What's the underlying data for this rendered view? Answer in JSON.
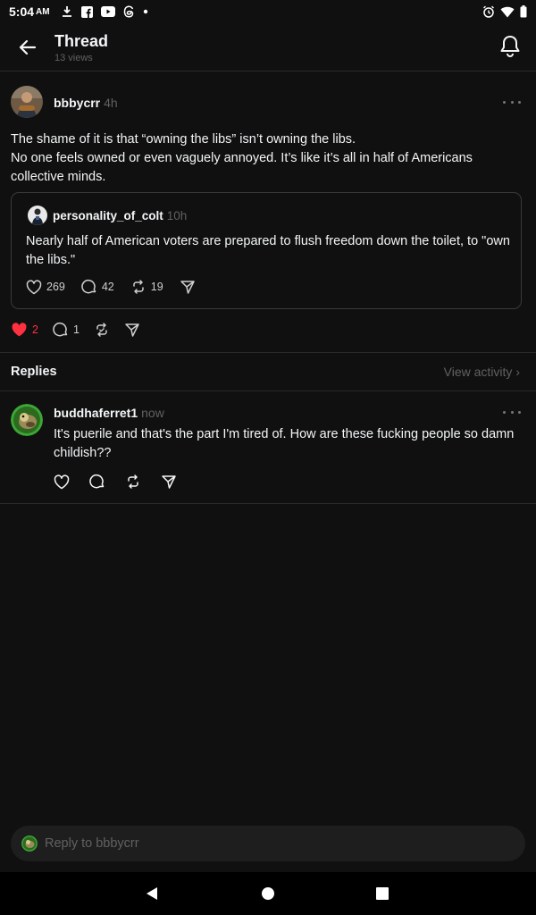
{
  "status_bar": {
    "time": "5:04",
    "ampm": "AM"
  },
  "header": {
    "title": "Thread",
    "views": "13 views"
  },
  "post": {
    "username": "bbbycrr",
    "time": "4h",
    "text_line1": "The shame of it is that “owning the libs” isn’t owning the libs.",
    "text_line2": "No one feels owned or even vaguely annoyed. It’s like it’s all in half of Americans collective minds.",
    "likes": "2",
    "replies": "1",
    "liked": true
  },
  "quote": {
    "username": "personality_of_colt",
    "time": "10h",
    "text": "Nearly half of American voters are prepared to flush freedom down the toilet, to \"own the libs.\"",
    "likes": "269",
    "replies": "42",
    "reposts": "19"
  },
  "replies_section": {
    "label": "Replies",
    "view_activity": "View activity"
  },
  "reply": {
    "username": "buddhaferret1",
    "time": "now",
    "text": "It's puerile and that's the part I'm tired of. How are these fucking people so damn childish??"
  },
  "composer": {
    "placeholder": "Reply to bbbycrr"
  },
  "colors": {
    "background": "#101010",
    "like_red": "#ff3040",
    "muted": "#616161",
    "text": "#f3f5f7"
  }
}
